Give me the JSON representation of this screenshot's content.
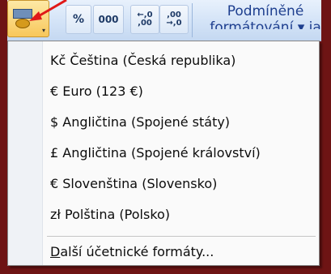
{
  "ribbon": {
    "accounting_button_icon": "accounting-format-icon",
    "percent_label": "%",
    "thousands_label": "000",
    "increase_decimal_top": "←,0",
    "increase_decimal_bottom": ",00",
    "decrease_decimal_top": ",00",
    "decrease_decimal_bottom": "→,0",
    "conditional_formatting_line1": "Podmíněné",
    "conditional_formatting_line2": "formátování ▾ ja"
  },
  "menu": {
    "items": [
      "Kč Čeština (Česká republika)",
      "€ Euro (123 €)",
      "$ Angličtina (Spojené státy)",
      "£ Angličtina (Spojené království)",
      "€ Slovenština (Slovensko)",
      "zł Polština (Polsko)"
    ],
    "more_prefix": "D",
    "more_rest": "alší účetnické formáty..."
  },
  "colors": {
    "frame": "#6e1414",
    "pointer": "#e01818"
  }
}
